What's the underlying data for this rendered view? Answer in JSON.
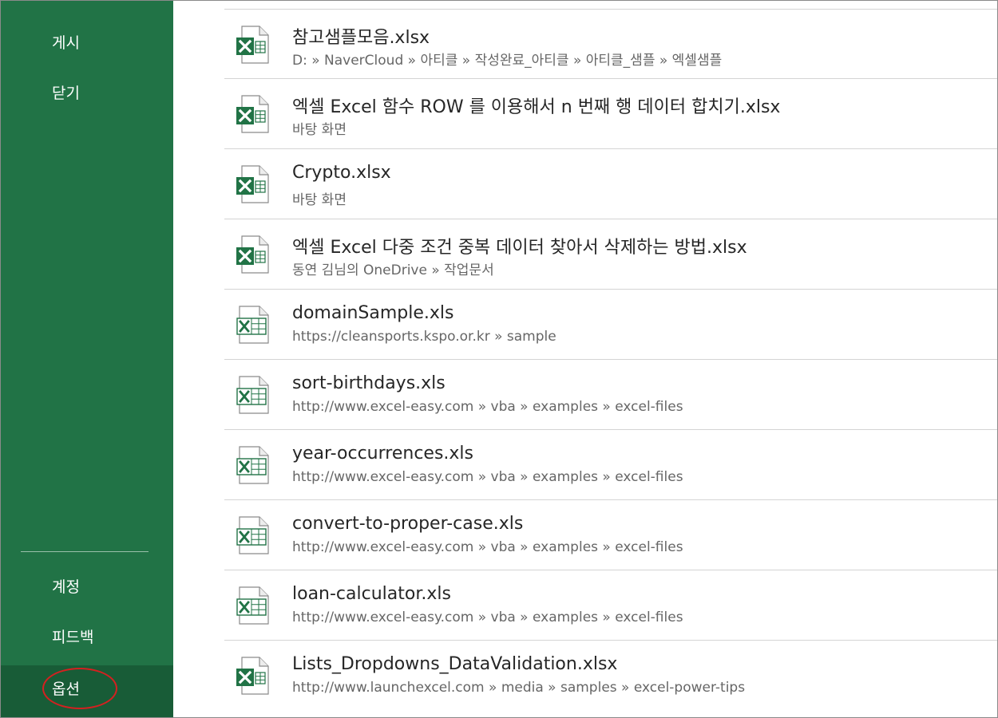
{
  "sidebar": {
    "items_top": [
      {
        "label": "게시"
      },
      {
        "label": "닫기"
      }
    ],
    "items_bottom": [
      {
        "label": "계정"
      },
      {
        "label": "피드백"
      },
      {
        "label": "옵션",
        "selected": true
      }
    ],
    "background_color": "#217346",
    "selected_background_color": "#185c37",
    "highlight_color": "#d42020"
  },
  "recent_files": [
    {
      "name": "참고샘플모음.xlsx",
      "path": "D: » NaverCloud » 아티클 » 작성완료_아티클 » 아티클_샘플 » 엑셀샘플",
      "icon": "excel-xlsx-icon"
    },
    {
      "name": "엑셀 Excel 함수 ROW 를 이용해서 n 번째 행 데이터 합치기.xlsx",
      "path": "바탕 화면",
      "icon": "excel-xlsx-icon"
    },
    {
      "name": "Crypto.xlsx",
      "path": "바탕 화면",
      "icon": "excel-xlsx-icon"
    },
    {
      "name": "엑셀 Excel 다중 조건 중복 데이터 찾아서 삭제하는 방법.xlsx",
      "path": "동연 김님의 OneDrive » 작업문서",
      "icon": "excel-xlsx-icon"
    },
    {
      "name": "domainSample.xls",
      "path": "https://cleansports.kspo.or.kr » sample",
      "icon": "excel-xls-icon"
    },
    {
      "name": "sort-birthdays.xls",
      "path": "http://www.excel-easy.com » vba » examples » excel-files",
      "icon": "excel-xls-icon"
    },
    {
      "name": "year-occurrences.xls",
      "path": "http://www.excel-easy.com » vba » examples » excel-files",
      "icon": "excel-xls-icon"
    },
    {
      "name": "convert-to-proper-case.xls",
      "path": "http://www.excel-easy.com » vba » examples » excel-files",
      "icon": "excel-xls-icon"
    },
    {
      "name": "loan-calculator.xls",
      "path": "http://www.excel-easy.com » vba » examples » excel-files",
      "icon": "excel-xls-icon"
    },
    {
      "name": "Lists_Dropdowns_DataValidation.xlsx",
      "path": "http://www.launchexcel.com » media » samples » excel-power-tips",
      "icon": "excel-xlsx-icon"
    }
  ]
}
